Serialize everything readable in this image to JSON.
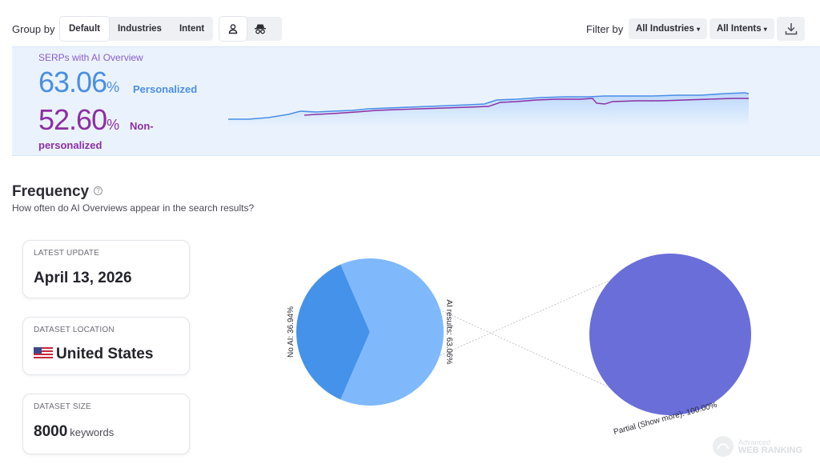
{
  "toolbar": {
    "group_by_label": "Group by",
    "group_options": [
      "Default",
      "Industries",
      "Intent"
    ],
    "filter_by_label": "Filter by",
    "industries_dropdown": "All Industries",
    "intents_dropdown": "All Intents",
    "icons": [
      "person-icon",
      "incognito-icon",
      "download-icon"
    ]
  },
  "banner": {
    "title": "SERPs with AI Overview",
    "personalized_value": "63.06",
    "personalized_unit": "%",
    "personalized_label": "Personalized",
    "nonpersonalized_value": "52.60",
    "nonpersonalized_unit": "%",
    "nonpersonalized_label_line1": "Non-",
    "nonpersonalized_label_line2": "personalized",
    "colors": {
      "personalized": "#4a8ee6",
      "nonpersonalized": "#8c2fa4"
    }
  },
  "frequency": {
    "title": "Frequency",
    "help_icon": "question-icon",
    "subtitle": "How often do AI Overviews appear in the search results?"
  },
  "cards": {
    "latest_update": {
      "caption": "LATEST UPDATE",
      "value": "April 13, 2026"
    },
    "dataset_location": {
      "caption": "DATASET LOCATION",
      "value": "United States",
      "icon": "us-flag-icon"
    },
    "dataset_size": {
      "caption": "DATASET SIZE",
      "value": "8000",
      "suffix": "keywords"
    }
  },
  "chart_data": [
    {
      "type": "pie",
      "categories": [
        "No AI",
        "AI results"
      ],
      "values": [
        36.94,
        63.06
      ],
      "labels": [
        "No AI: 36.94%",
        "AI results: 63.06%"
      ],
      "colors": [
        "#4592ea",
        "#7fb9fb"
      ]
    },
    {
      "type": "pie",
      "categories": [
        "Partial (Show more)"
      ],
      "values": [
        100.0
      ],
      "labels": [
        "Partial (Show more): 100.00%"
      ],
      "colors": [
        "#6a6ed9"
      ]
    }
  ],
  "watermark": {
    "line1": "Advanced",
    "line2": "WEB RANKING"
  }
}
